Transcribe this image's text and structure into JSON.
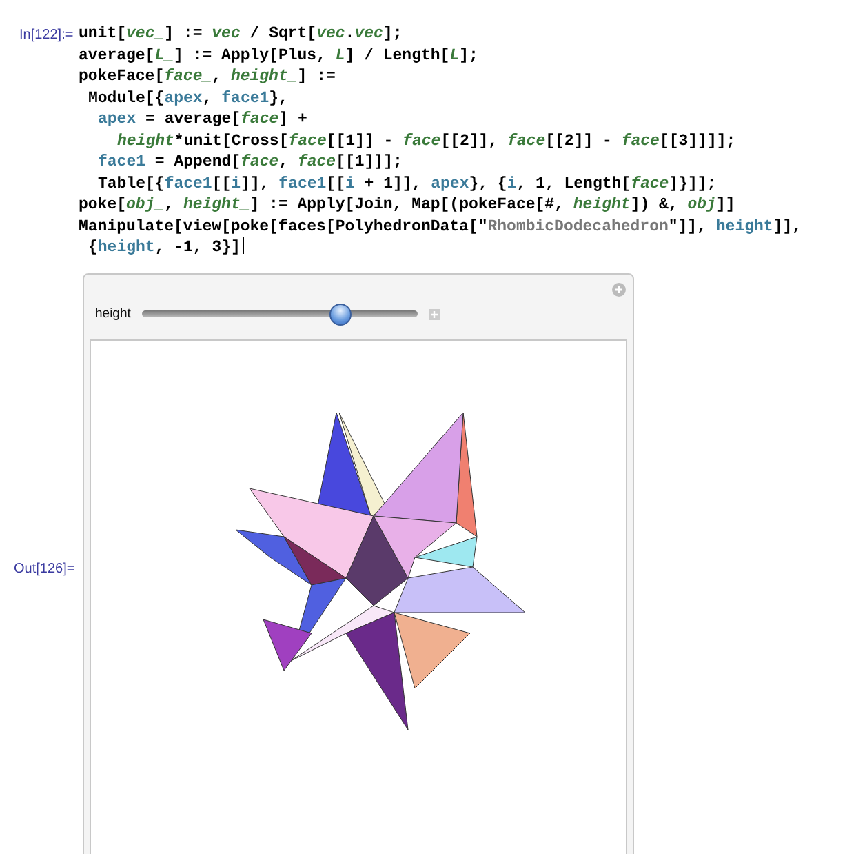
{
  "input_cell": {
    "label": "In[122]:=",
    "lines": [
      {
        "kind": "top",
        "tokens": [
          {
            "kind": "sym",
            "text": "unit["
          },
          {
            "kind": "pat",
            "text": "vec_"
          },
          {
            "kind": "sym",
            "text": "] := "
          },
          {
            "kind": "pat",
            "text": "vec"
          },
          {
            "kind": "sym",
            "text": " / Sqrt["
          },
          {
            "kind": "pat",
            "text": "vec"
          },
          {
            "kind": "sym",
            "text": "."
          },
          {
            "kind": "pat",
            "text": "vec"
          },
          {
            "kind": "sym",
            "text": "];"
          }
        ]
      },
      {
        "kind": "top",
        "tokens": [
          {
            "kind": "sym",
            "text": "average["
          },
          {
            "kind": "pat",
            "text": "L_"
          },
          {
            "kind": "sym",
            "text": "] := Apply[Plus, "
          },
          {
            "kind": "pat",
            "text": "L"
          },
          {
            "kind": "sym",
            "text": "] / Length["
          },
          {
            "kind": "pat",
            "text": "L"
          },
          {
            "kind": "sym",
            "text": "];"
          }
        ]
      },
      {
        "kind": "top",
        "tokens": [
          {
            "kind": "sym",
            "text": "pokeFace["
          },
          {
            "kind": "pat",
            "text": "face_"
          },
          {
            "kind": "sym",
            "text": ", "
          },
          {
            "kind": "pat",
            "text": "height_"
          },
          {
            "kind": "sym",
            "text": "] :="
          }
        ]
      },
      {
        "kind": "block",
        "tokens": [
          {
            "kind": "sym",
            "text": "Module[{"
          },
          {
            "kind": "local",
            "text": "apex"
          },
          {
            "kind": "sym",
            "text": ", "
          },
          {
            "kind": "local",
            "text": "face1"
          },
          {
            "kind": "sym",
            "text": "},"
          }
        ]
      },
      {
        "kind": "stmt",
        "tokens": [
          {
            "kind": "local",
            "text": "apex"
          },
          {
            "kind": "sym",
            "text": " = average["
          },
          {
            "kind": "pat",
            "text": "face"
          },
          {
            "kind": "sym",
            "text": "] +"
          }
        ]
      },
      {
        "kind": "cont",
        "tokens": [
          {
            "kind": "pat",
            "text": "height"
          },
          {
            "kind": "sym",
            "text": "*unit[Cross["
          },
          {
            "kind": "pat",
            "text": "face"
          },
          {
            "kind": "sym",
            "text": "[[1]] - "
          },
          {
            "kind": "pat",
            "text": "face"
          },
          {
            "kind": "sym",
            "text": "[[2]], "
          },
          {
            "kind": "pat",
            "text": "face"
          },
          {
            "kind": "sym",
            "text": "[[2]] - "
          },
          {
            "kind": "pat",
            "text": "face"
          },
          {
            "kind": "sym",
            "text": "[[3]]]];"
          }
        ]
      },
      {
        "kind": "stmt",
        "tokens": [
          {
            "kind": "local",
            "text": "face1"
          },
          {
            "kind": "sym",
            "text": " = Append["
          },
          {
            "kind": "pat",
            "text": "face"
          },
          {
            "kind": "sym",
            "text": ", "
          },
          {
            "kind": "pat",
            "text": "face"
          },
          {
            "kind": "sym",
            "text": "[[1]]];"
          }
        ]
      },
      {
        "kind": "stmt",
        "tokens": [
          {
            "kind": "sym",
            "text": "Table[{"
          },
          {
            "kind": "local",
            "text": "face1"
          },
          {
            "kind": "sym",
            "text": "[["
          },
          {
            "kind": "local",
            "text": "i"
          },
          {
            "kind": "sym",
            "text": "]], "
          },
          {
            "kind": "local",
            "text": "face1"
          },
          {
            "kind": "sym",
            "text": "[["
          },
          {
            "kind": "local",
            "text": "i"
          },
          {
            "kind": "sym",
            "text": " + 1]], "
          },
          {
            "kind": "local",
            "text": "apex"
          },
          {
            "kind": "sym",
            "text": "}, {"
          },
          {
            "kind": "local",
            "text": "i"
          },
          {
            "kind": "sym",
            "text": ", 1, Length["
          },
          {
            "kind": "pat",
            "text": "face"
          },
          {
            "kind": "sym",
            "text": "]}]];"
          }
        ]
      },
      {
        "kind": "top",
        "tokens": [
          {
            "kind": "sym",
            "text": "poke["
          },
          {
            "kind": "pat",
            "text": "obj_"
          },
          {
            "kind": "sym",
            "text": ", "
          },
          {
            "kind": "pat",
            "text": "height_"
          },
          {
            "kind": "sym",
            "text": "] := Apply[Join, Map[(pokeFace[#, "
          },
          {
            "kind": "pat",
            "text": "height"
          },
          {
            "kind": "sym",
            "text": "]) &, "
          },
          {
            "kind": "pat",
            "text": "obj"
          },
          {
            "kind": "sym",
            "text": "]]"
          }
        ]
      },
      {
        "kind": "top",
        "tokens": [
          {
            "kind": "sym",
            "text": "Manipulate[view[poke[faces[PolyhedronData[\""
          },
          {
            "kind": "str",
            "text": "RhombicDodecahedron"
          },
          {
            "kind": "sym",
            "text": "\"]], "
          },
          {
            "kind": "local",
            "text": "height"
          },
          {
            "kind": "sym",
            "text": "]],"
          }
        ]
      },
      {
        "kind": "block",
        "tokens": [
          {
            "kind": "sym",
            "text": "{"
          },
          {
            "kind": "local",
            "text": "height"
          },
          {
            "kind": "sym",
            "text": ", -1, 3}]"
          }
        ]
      }
    ]
  },
  "output_cell": {
    "label": "Out[126]=",
    "manipulate": {
      "control": {
        "label": "height",
        "level": 0.72
      }
    }
  }
}
